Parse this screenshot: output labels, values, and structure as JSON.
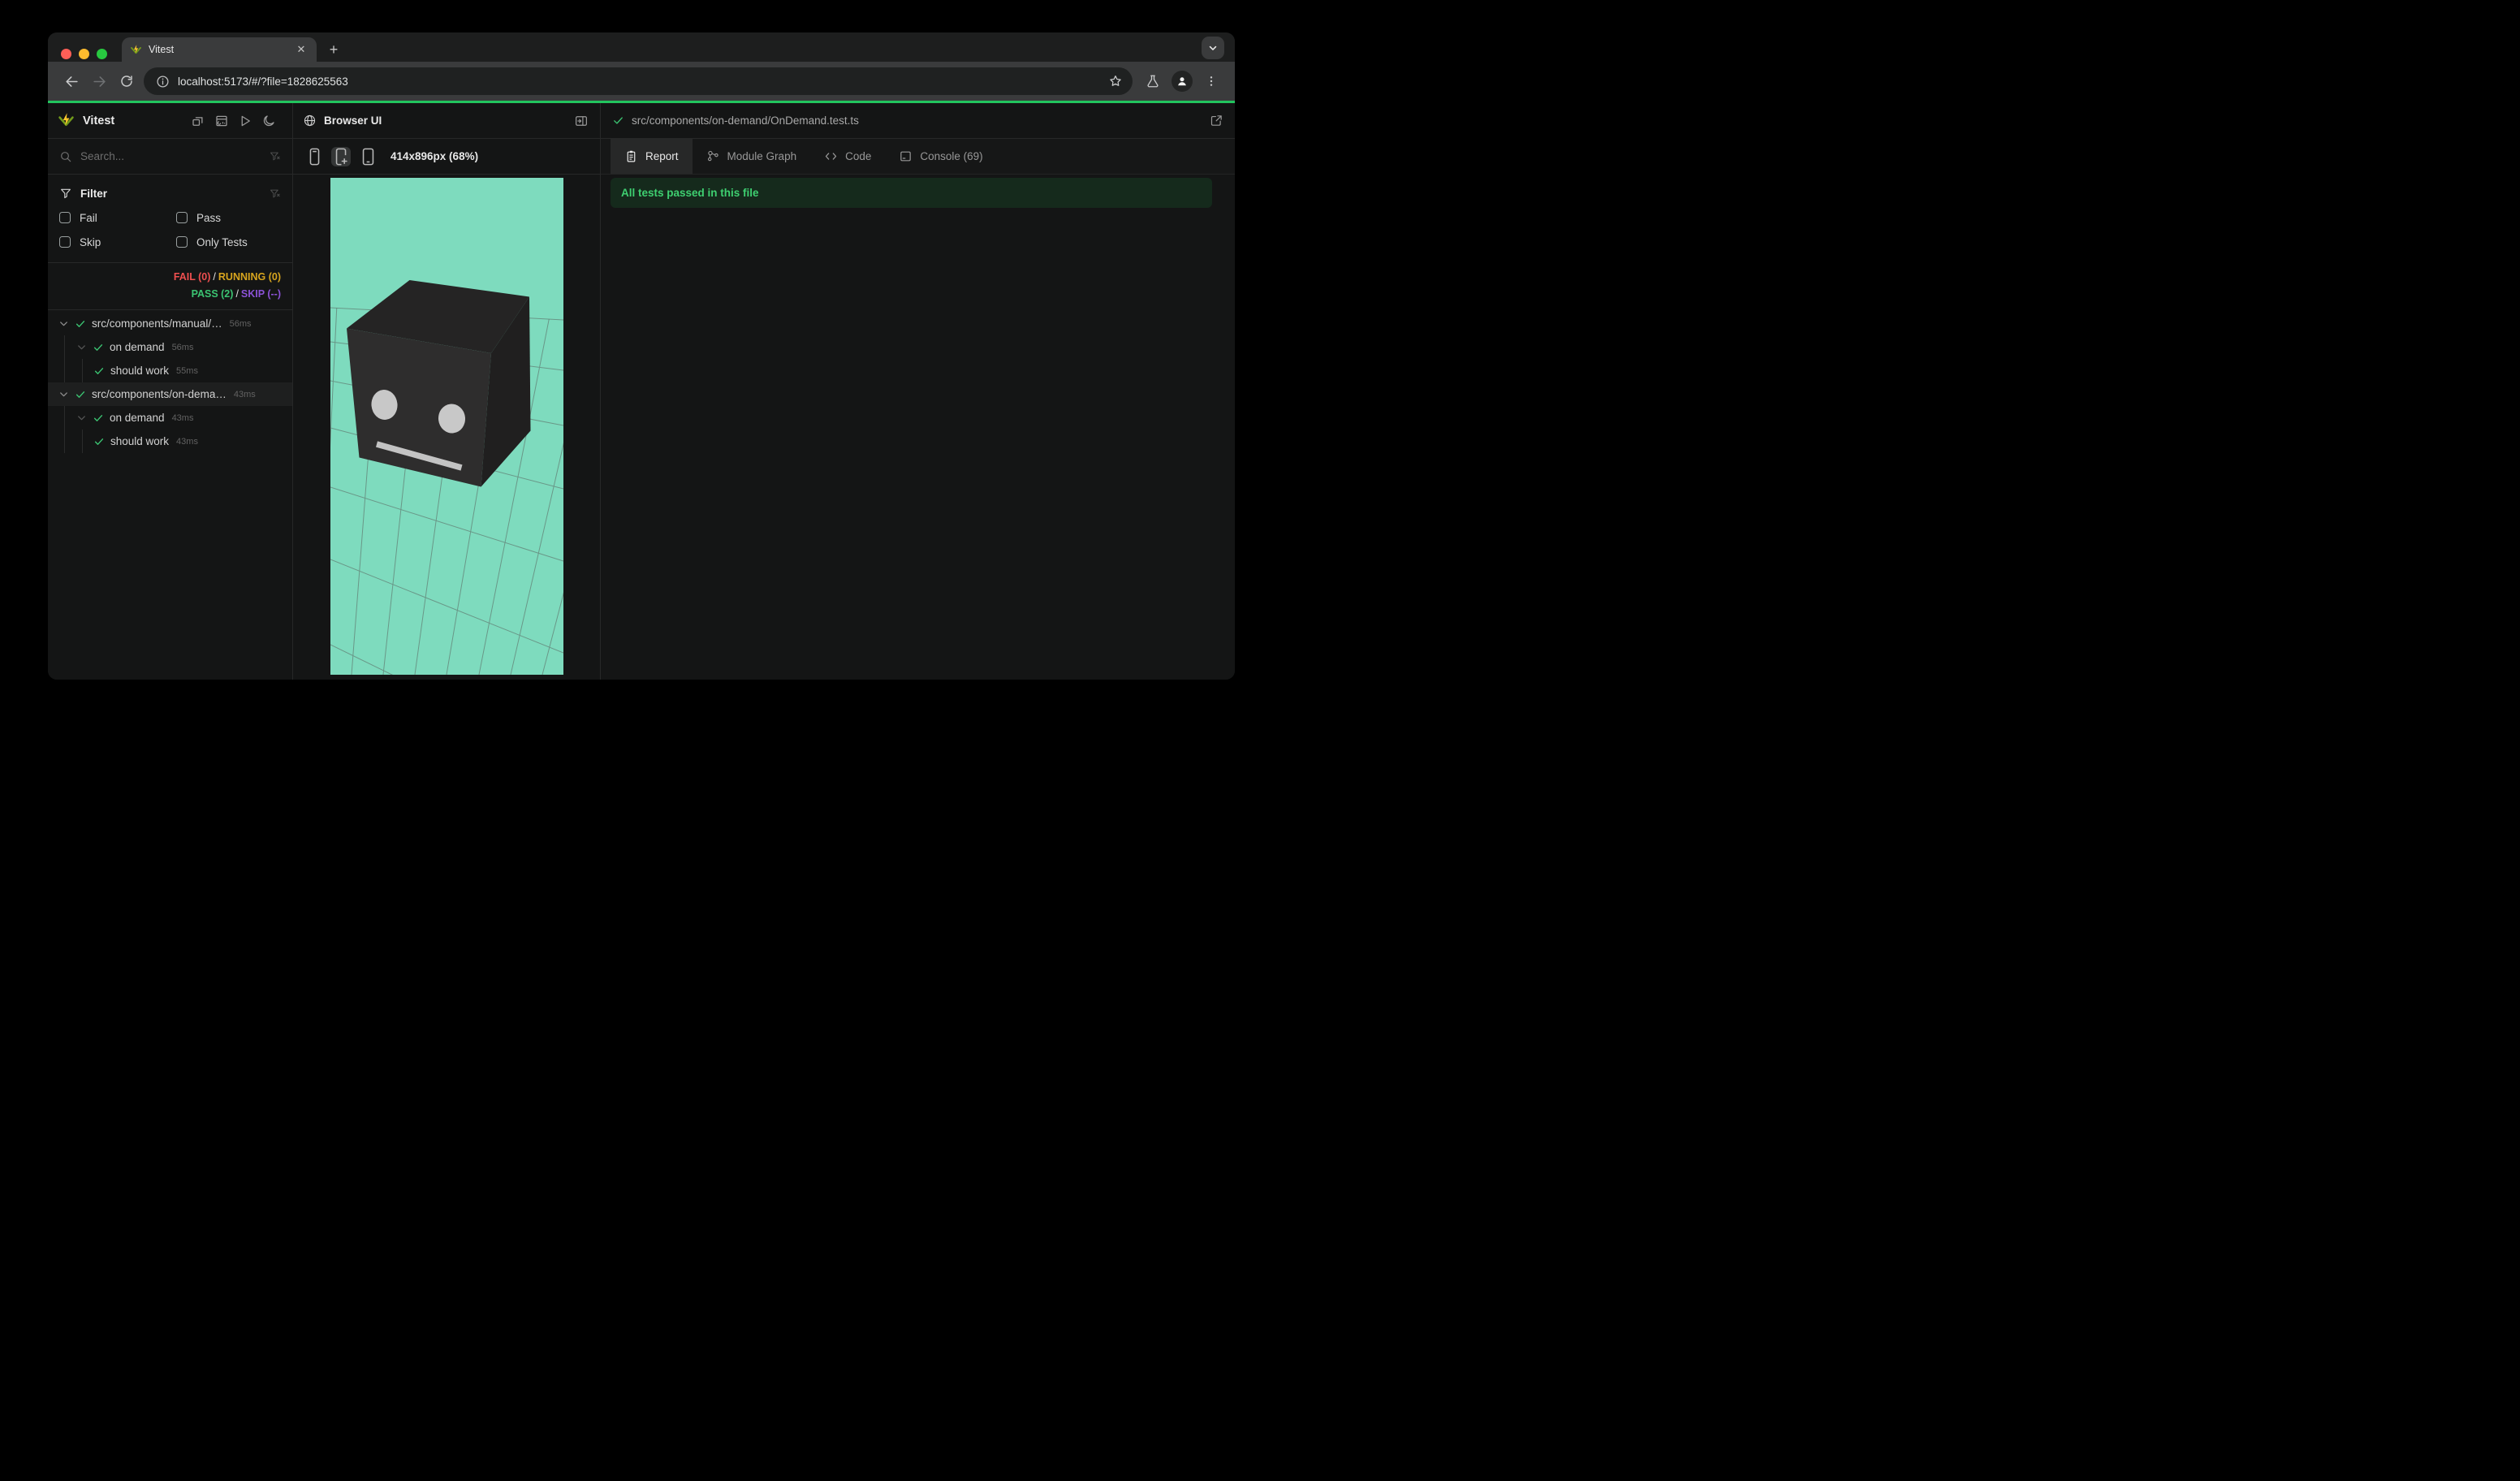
{
  "colors": {
    "accent_green": "#22c55e",
    "pass_green": "#3bc472",
    "fail_red": "#ee4f4f",
    "running_yellow": "#d7a41e",
    "skip_purple": "#8b52d6",
    "banner_bg": "#152a1c",
    "banner_text": "#3ecf70",
    "viewport_bg": "#7edbbe",
    "logo_yellow": "#fcc72b",
    "logo_green": "#729b1b",
    "cube_top": "#252424",
    "cube_front": "#2e2d2d",
    "cube_right": "#201f1f",
    "cube_face_features": "#c8c8c8",
    "grid_line": "#5c6a64"
  },
  "chrome": {
    "tab_title": "Vitest",
    "url": "localhost:5173/#/?file=1828625563"
  },
  "sidebar": {
    "brand": "Vitest",
    "search_placeholder": "Search...",
    "filter": {
      "title": "Filter",
      "options": [
        "Fail",
        "Pass",
        "Skip",
        "Only Tests"
      ]
    },
    "summary": {
      "fail": "FAIL (0)",
      "running": "RUNNING (0)",
      "pass": "PASS (2)",
      "skip": "SKIP (--)",
      "separator": "/"
    },
    "tree": [
      {
        "level": 0,
        "chevron": true,
        "label": "src/components/manual/…",
        "duration": "56ms",
        "selected": false
      },
      {
        "level": 1,
        "chevron": true,
        "label": "on demand",
        "duration": "56ms",
        "selected": false
      },
      {
        "level": 2,
        "chevron": false,
        "label": "should work",
        "duration": "55ms",
        "selected": false
      },
      {
        "level": 0,
        "chevron": true,
        "label": "src/components/on-dema…",
        "duration": "43ms",
        "selected": true
      },
      {
        "level": 1,
        "chevron": true,
        "label": "on demand",
        "duration": "43ms",
        "selected": false
      },
      {
        "level": 2,
        "chevron": false,
        "label": "should work",
        "duration": "43ms",
        "selected": false
      }
    ]
  },
  "preview": {
    "title": "Browser UI",
    "size_label": "414x896px (68%)",
    "devices": [
      "phone-small",
      "phone-plus",
      "tablet"
    ],
    "selected_device_index": 1
  },
  "results": {
    "file": "src/components/on-demand/OnDemand.test.ts",
    "tabs": [
      {
        "label": "Report",
        "icon": "report",
        "active": true
      },
      {
        "label": "Module Graph",
        "icon": "graph",
        "active": false
      },
      {
        "label": "Code",
        "icon": "code",
        "active": false
      },
      {
        "label": "Console (69)",
        "icon": "console",
        "active": false
      }
    ],
    "banner": "All tests passed in this file"
  }
}
